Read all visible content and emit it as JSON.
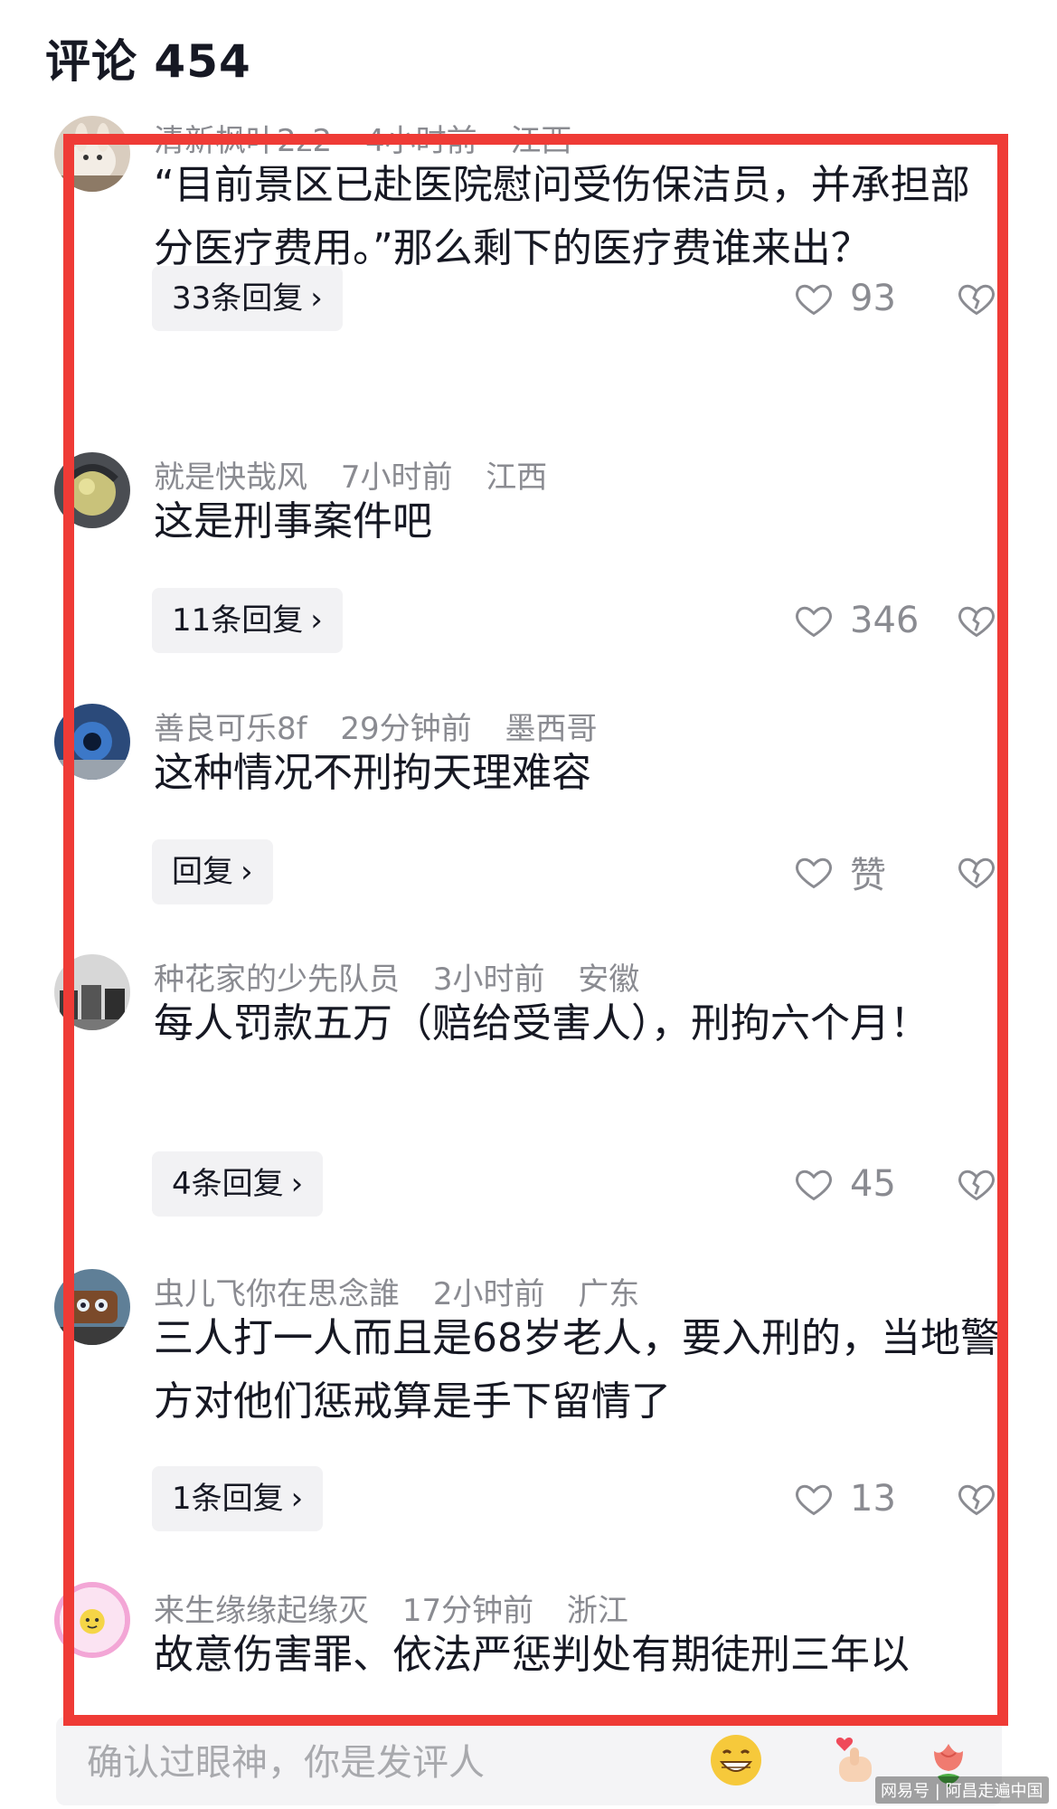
{
  "header": {
    "title": "评论 454"
  },
  "comments": [
    {
      "user": "清新枫叶2z2",
      "time": "4小时前",
      "location": "江西",
      "text": "“目前景区已赴医院慰问受伤保洁员，并承担部分医疗费用。”那么剩下的医疗费谁来出？",
      "replies": "33条回复",
      "likes": "93"
    },
    {
      "user": "就是快哉风",
      "time": "7小时前",
      "location": "江西",
      "text": "这是刑事案件吧",
      "replies": "11条回复",
      "likes": "346"
    },
    {
      "user": "善良可乐8f",
      "time": "29分钟前",
      "location": "墨西哥",
      "text": "这种情况不刑拘天理难容",
      "replies": "回复",
      "likes": "赞"
    },
    {
      "user": "种花家的少先队员",
      "time": "3小时前",
      "location": "安徽",
      "text": "每人罚款五万（赔给受害人），刑拘六个月！",
      "replies": "4条回复",
      "likes": "45"
    },
    {
      "user": "虫儿飞你在思念誰",
      "time": "2小时前",
      "location": "广东",
      "text": "三人打一人而且是68岁老人，要入刑的，当地警方对他们惩戒算是手下留情了",
      "replies": "1条回复",
      "likes": "13"
    },
    {
      "user": "来生缘缘起缘灭",
      "time": "17分钟前",
      "location": "浙江",
      "text": "故意伤害罪、依法严惩判处有期徒刑三年以"
    }
  ],
  "input": {
    "placeholder": "确认过眼神，你是发评人"
  },
  "watermark": "网易号 | 阿昌走遍中国",
  "colors": {
    "highlight_border": "#ef3b36",
    "muted_text": "#8a8b91",
    "reply_bg": "#f2f2f4"
  },
  "icons": [
    "heart-outline-icon",
    "broken-heart-icon",
    "grin-emoji-icon",
    "finger-heart-emoji-icon",
    "rose-emoji-icon",
    "chevron-right-icon"
  ]
}
